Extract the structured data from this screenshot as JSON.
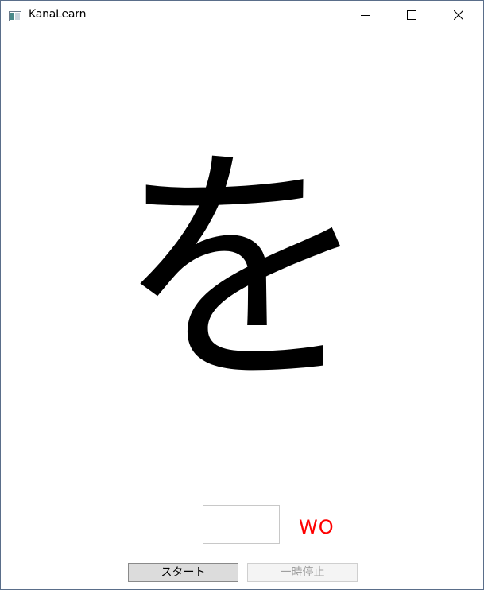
{
  "window": {
    "title": "KanaLearn",
    "app_icon": "app-window-icon",
    "controls": {
      "minimize_icon": "minimize-icon",
      "maximize_icon": "maximize-icon",
      "close_icon": "close-icon"
    }
  },
  "quiz": {
    "kana_character": "を",
    "answer_input_value": "",
    "romaji": "WO",
    "romaji_color": "#ff0000"
  },
  "controls": {
    "start_label": "スタート",
    "pause_label": "一時停止",
    "pause_enabled": false
  }
}
